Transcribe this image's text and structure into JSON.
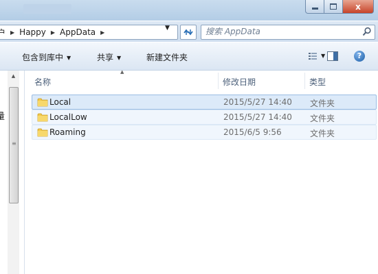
{
  "window": {
    "close_glyph": "x"
  },
  "address": {
    "partial_left": "户",
    "breadcrumbs": [
      "Happy",
      "AppData"
    ]
  },
  "search": {
    "placeholder": "搜索 AppData"
  },
  "toolbar": {
    "include_library": "包含到库中",
    "share": "共享",
    "new_folder": "新建文件夹",
    "help": "?"
  },
  "nav": {
    "partial_item": "量"
  },
  "columns": {
    "name": "名称",
    "date_modified": "修改日期",
    "type": "类型"
  },
  "files": [
    {
      "name": "Local",
      "date": "2015/5/27 14:40",
      "type": "文件夹",
      "state": "selected"
    },
    {
      "name": "LocalLow",
      "date": "2015/5/27 14:40",
      "type": "文件夹",
      "state": "hover"
    },
    {
      "name": "Roaming",
      "date": "2015/6/5 9:56",
      "type": "文件夹",
      "state": "hover"
    }
  ],
  "colors": {
    "selection_fill": "#dceaf9",
    "selection_border": "#99bce3",
    "folder_yellow": "#f2c94c",
    "accent_blue": "#2a6fb5"
  },
  "icons": {
    "folder": "folder-icon",
    "search": "search-icon",
    "refresh": "refresh-icon",
    "view": "view-options-icon",
    "preview_pane": "preview-pane-icon",
    "help": "help-icon"
  }
}
